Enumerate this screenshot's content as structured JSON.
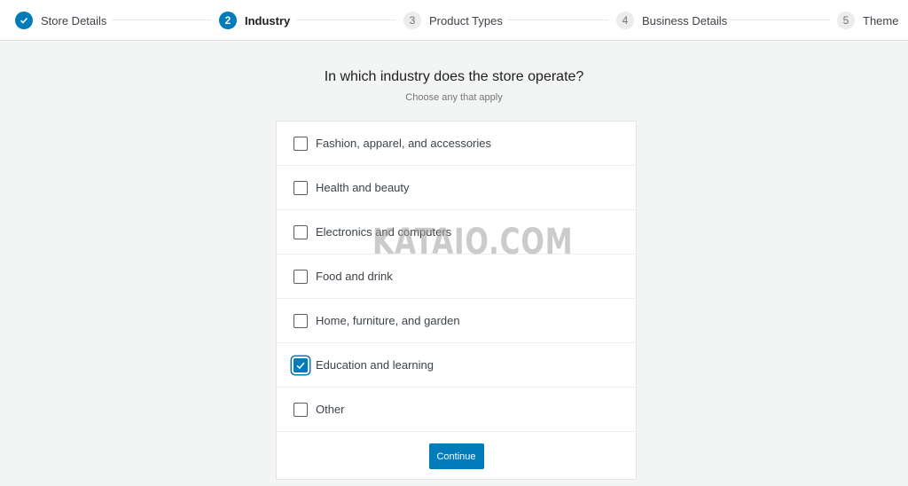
{
  "stepper": {
    "steps": [
      {
        "number": "1",
        "label": "Store Details",
        "status": "done",
        "icon": "check-icon"
      },
      {
        "number": "2",
        "label": "Industry",
        "status": "active"
      },
      {
        "number": "3",
        "label": "Product Types",
        "status": "pending"
      },
      {
        "number": "4",
        "label": "Business Details",
        "status": "pending"
      },
      {
        "number": "5",
        "label": "Theme",
        "status": "pending"
      }
    ]
  },
  "main": {
    "title": "In which industry does the store operate?",
    "subtitle": "Choose any that apply",
    "options": [
      {
        "label": "Fashion, apparel, and accessories",
        "checked": false
      },
      {
        "label": "Health and beauty",
        "checked": false
      },
      {
        "label": "Electronics and computers",
        "checked": false
      },
      {
        "label": "Food and drink",
        "checked": false
      },
      {
        "label": "Home, furniture, and garden",
        "checked": false
      },
      {
        "label": "Education and learning",
        "checked": true
      },
      {
        "label": "Other",
        "checked": false
      }
    ],
    "continue_label": "Continue"
  },
  "watermark": "KATAIO.COM",
  "colors": {
    "accent": "#007cba"
  }
}
